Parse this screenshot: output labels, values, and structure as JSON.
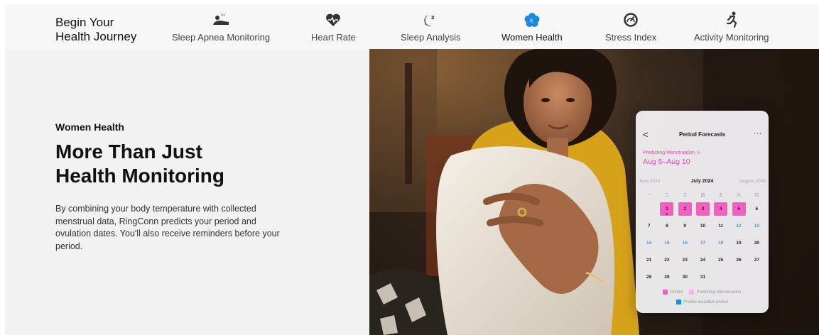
{
  "brand": {
    "line1": "Begin Your",
    "line2": "Health Journey"
  },
  "nav": {
    "tabs": [
      {
        "label": "Sleep Apnea Monitoring",
        "icon": "sleep-apnea-icon"
      },
      {
        "label": "Heart Rate",
        "icon": "heart-rate-icon"
      },
      {
        "label": "Sleep Analysis",
        "icon": "sleep-analysis-icon"
      },
      {
        "label": "Women Health",
        "icon": "women-health-icon",
        "active": true
      },
      {
        "label": "Stress Index",
        "icon": "stress-gauge-icon"
      },
      {
        "label": "Activity Monitoring",
        "icon": "running-person-icon"
      }
    ]
  },
  "hero": {
    "eyebrow": "Women Health",
    "headline_line1": "More Than Just",
    "headline_line2": "Health Monitoring",
    "body": "By combining your body temperature with collected menstrual data, RingConn predicts your period and ovulation dates. You'll also receive reminders before your period."
  },
  "card": {
    "back": "<",
    "title": "Period Forecasts",
    "more": "...",
    "predict_label": "Predicting Menstruation ⊙",
    "predict_dates": "Aug 5–Aug 10",
    "month_prev": "June 2023",
    "month_current": "July 2024",
    "month_next": "August 2024",
    "weekdays": [
      "一",
      "二",
      "三",
      "四",
      "五",
      "六",
      "日"
    ],
    "weeks": [
      [
        "",
        "1",
        "2",
        "3",
        "4",
        "5",
        "6"
      ],
      [
        "7",
        "8",
        "9",
        "10",
        "11",
        "12",
        "13"
      ],
      [
        "14",
        "15",
        "16",
        "17",
        "18",
        "19",
        "20"
      ],
      [
        "21",
        "22",
        "23",
        "24",
        "25",
        "26",
        "27"
      ],
      [
        "28",
        "29",
        "30",
        "31",
        "",
        "",
        ""
      ]
    ],
    "legend_period": "Period",
    "legend_predict": "Predicting Menstruation",
    "legend_ovulation": "Predict ovulation period"
  },
  "colors": {
    "period": "#f25ec2",
    "predict": "#f9b6e2",
    "ovulation": "#3a9bea",
    "accent_pink": "#e04fa8",
    "icon_blue": "#1e87e0"
  }
}
